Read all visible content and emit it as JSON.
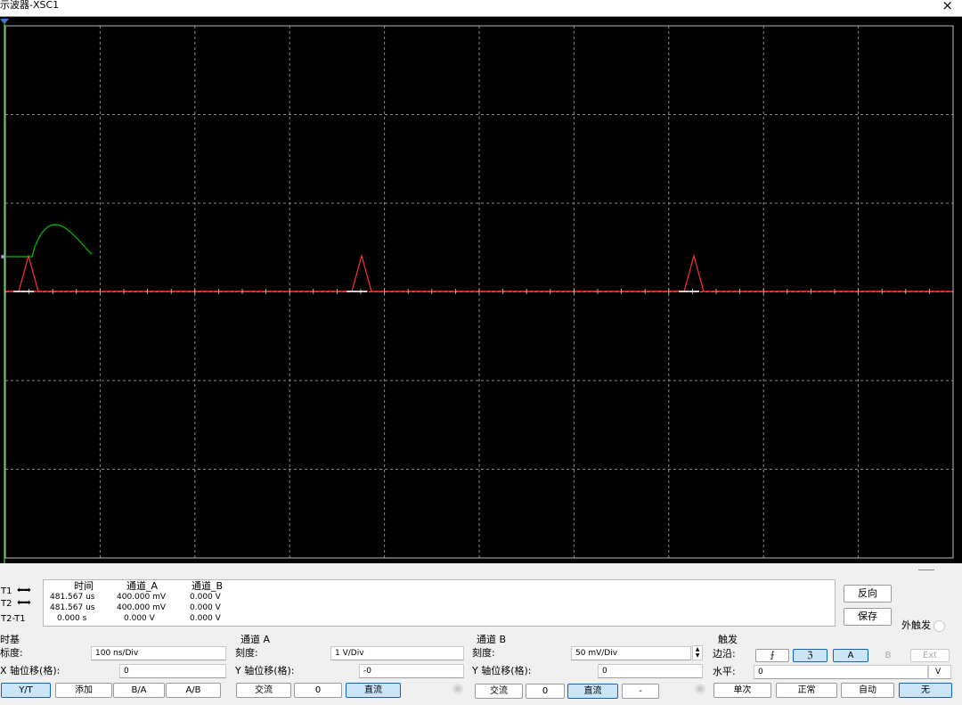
{
  "window": {
    "title": "示波器-XSC1",
    "close_glyph": "×"
  },
  "screen": {
    "background": "#000000",
    "grid_color": "#8a8a8a",
    "trace_a_color": "#00c000",
    "trace_b_color": "#ff3030",
    "cursor1_color": "#3fd03f"
  },
  "cursors": {
    "t1_label": "T1",
    "t2_label": "T2",
    "diff_label": "T2-T1",
    "arrow_glyph": "⬅➡"
  },
  "readout": {
    "headers": [
      "时间",
      "通道_A",
      "通道_B"
    ],
    "rows": [
      [
        "481.567 us",
        "400.000 mV",
        "0.000 V"
      ],
      [
        "481.567 us",
        "400.000 mV",
        "0.000 V"
      ],
      [
        "0.000 s",
        "0.000 V",
        "0.000 V"
      ]
    ],
    "reverse_button": "反向",
    "save_button": "保存",
    "ext_trigger_label": "外触发"
  },
  "timebase": {
    "title": "时基",
    "scale_label": "标度:",
    "scale_value": "100 ns/Div",
    "xpos_label": "X 轴位移(格):",
    "xpos_value": "0",
    "buttons": [
      "Y/T",
      "添加",
      "B/A",
      "A/B"
    ]
  },
  "channel_a": {
    "title": "通道 A",
    "scale_label": "刻度:",
    "scale_value": "1  V/Div",
    "ypos_label": "Y 轴位移(格):",
    "ypos_value": "-0",
    "buttons": [
      "交流",
      "0",
      "直流"
    ]
  },
  "channel_b": {
    "title": "通道 B",
    "scale_label": "刻度:",
    "scale_value": "50 mV/Div",
    "ypos_label": "Y 轴位移(格):",
    "ypos_value": "0",
    "buttons": [
      "交流",
      "0",
      "直流",
      "-"
    ]
  },
  "trigger": {
    "title": "触发",
    "edge_label": "边沿:",
    "edge_buttons": [
      "⨍",
      "ℨ",
      "A",
      "B",
      "Ext"
    ],
    "level_label": "水平:",
    "level_value": "0",
    "level_unit": "V",
    "mode_buttons": [
      "单次",
      "正常",
      "自动",
      "无"
    ]
  }
}
